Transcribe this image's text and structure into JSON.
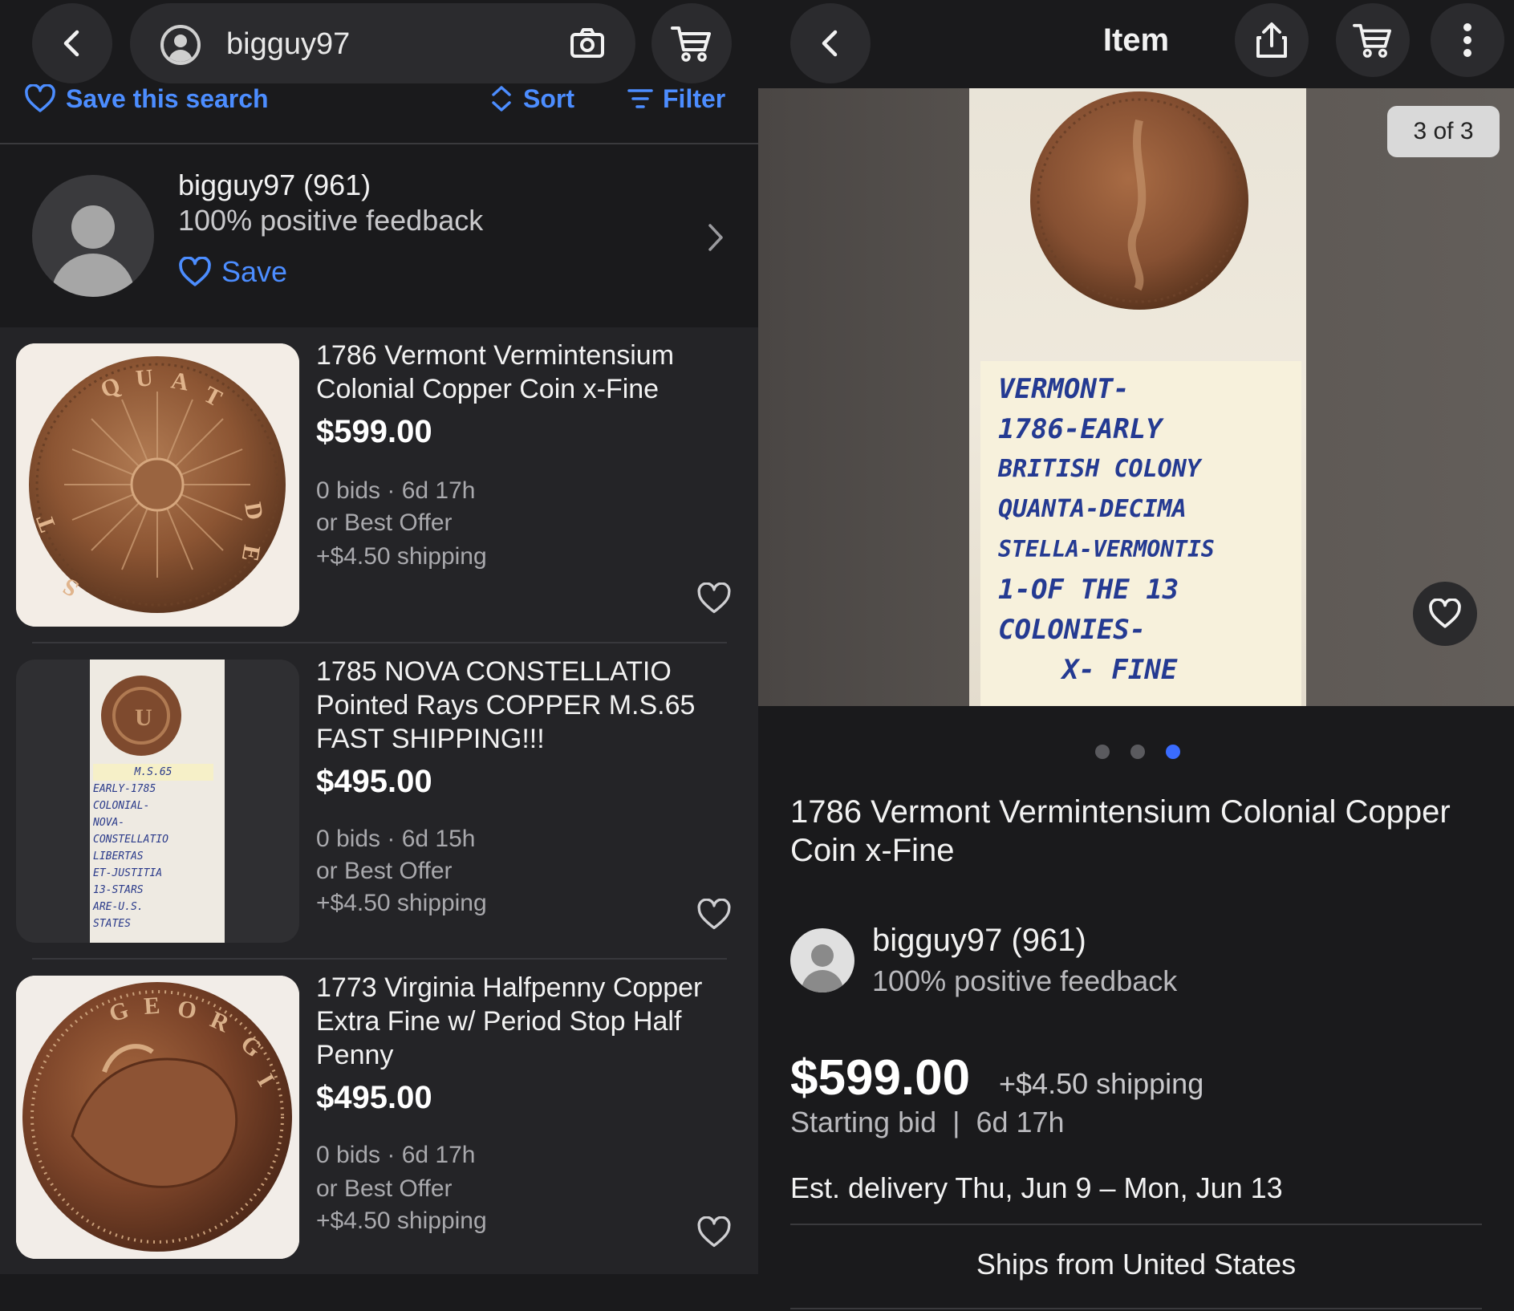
{
  "left": {
    "search": {
      "query": "bigguy97"
    },
    "toolbar": {
      "save_search": "Save this search",
      "sort": "Sort",
      "filter": "Filter"
    },
    "seller": {
      "name": "bigguy97 (961)",
      "feedback": "100% positive feedback",
      "save": "Save"
    },
    "listings": [
      {
        "title": "1786 Vermont Vermintensium Colonial Copper Coin x-Fine",
        "price": "$599.00",
        "bids": "0 bids · 6d 17h",
        "offer": "or Best Offer",
        "shipping": "+$4.50 shipping"
      },
      {
        "title": "1785 NOVA CONSTELLATIO Pointed Rays COPPER M.S.65 FAST SHIPPING!!!",
        "price": "$495.00",
        "bids": "0 bids · 6d 15h",
        "offer": "or Best Offer",
        "shipping": "+$4.50 shipping",
        "label_lines": [
          "M.S.65",
          "EARLY-1785",
          "COLONIAL-",
          "NOVA-",
          "CONSTELLATIO",
          "LIBERTAS",
          "ET-JUSTITIA",
          "13-STARS",
          "ARE-U.S.",
          "STATES"
        ]
      },
      {
        "title": "1773 Virginia Halfpenny Copper Extra Fine w/ Period Stop Half Penny",
        "price": "$495.00",
        "bids": "0 bids · 6d 17h",
        "offer": "or Best Offer",
        "shipping": "+$4.50 shipping"
      }
    ]
  },
  "right": {
    "header_title": "Item",
    "photo_counter": "3 of 3",
    "photo_label_lines": [
      "VERMONT-",
      "1786-EARLY",
      "BRITISH COLONY",
      "QUANTA-DECIMA",
      "STELLA-VERMONTIS",
      "1-OF THE 13",
      "COLONIES-",
      "X- FINE"
    ],
    "title": "1786 Vermont Vermintensium Colonial Copper Coin x-Fine",
    "seller": {
      "name": "bigguy97 (961)",
      "feedback": "100% positive feedback"
    },
    "price": "$599.00",
    "shipping": "+$4.50 shipping",
    "bid_info": "Starting bid  |  6d 17h",
    "delivery": "Est. delivery Thu, Jun 9 – Mon, Jun 13",
    "ships_from": "Ships from United States"
  },
  "icons": [
    "back-icon",
    "camera-icon",
    "cart-icon",
    "heart-icon",
    "sort-icon",
    "filter-icon",
    "chevron-right-icon",
    "share-icon",
    "more-vertical-icon"
  ],
  "colors": {
    "background": "#1a1a1c",
    "card": "#242427",
    "accent": "#4c8dff",
    "dot_active": "#3a6cff"
  }
}
